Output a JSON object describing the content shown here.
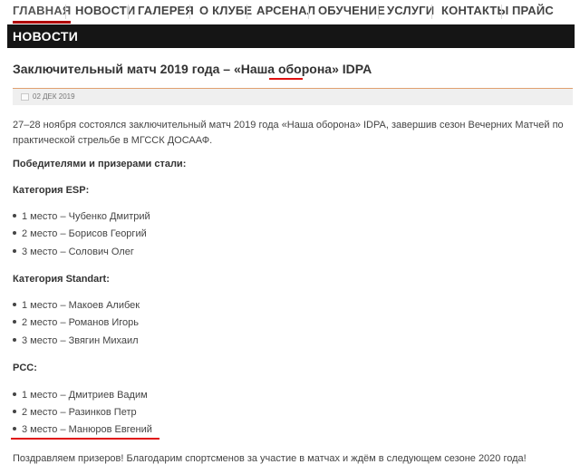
{
  "nav": {
    "items": [
      "ГЛАВНАЯ",
      "НОВОСТИ",
      "ГАЛЕРЕЯ",
      "О КЛУБЕ",
      "АРСЕНАЛ",
      "ОБУЧЕНИЕ",
      "УСЛУГИ",
      "КОНТАКТЫ",
      "ПРАЙС"
    ],
    "active": "ГЛАВНАЯ"
  },
  "section": {
    "title": "НОВОСТИ"
  },
  "article": {
    "title_main": "Заключительный матч 2019 года – «Наша оборона» ",
    "title_tag": "IDPA",
    "date": "02 ДЕК 2019",
    "intro": "27–28 ноября состоялся заключительный матч 2019 года «Наша оборона» IDPA, завершив сезон Вечерних Матчей по практической стрельбе в МГССК ДОСААФ.",
    "winners_heading": "Победителями и призерами стали:",
    "categories": [
      {
        "name": "Категория ESP:",
        "places": [
          "1 место – Чубенко Дмитрий",
          "2 место – Борисов Георгий",
          "3 место – Солович Олег"
        ]
      },
      {
        "name": "Категория Standart:",
        "places": [
          "1 место – Макоев Алибек",
          "2 место – Романов Игорь",
          "3 место – Звягин Михаил"
        ]
      },
      {
        "name": "PCC:",
        "places": [
          "1 место – Дмитриев Вадим",
          "2 место – Разинков Петр",
          "3 место – Манюров Евгений"
        ]
      }
    ],
    "closing": "Поздравляем призеров! Благодарим спортсменов за участие в матчах и ждём в следующем сезоне 2020 года!"
  },
  "colors": {
    "accent": "#b00000",
    "highlight_underline": "#e01010",
    "bar": "#151515"
  }
}
